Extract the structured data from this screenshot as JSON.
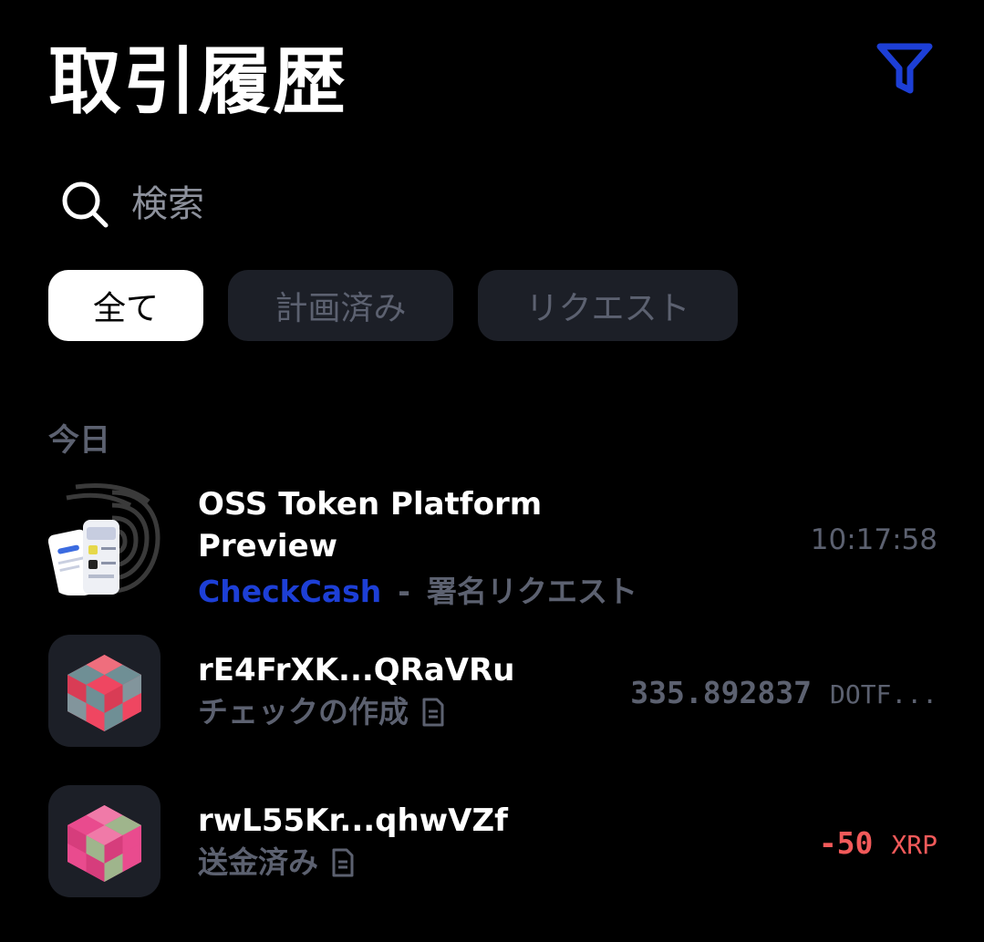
{
  "header": {
    "title": "取引履歴",
    "filter_icon": "filter-icon"
  },
  "search": {
    "placeholder": "検索",
    "value": ""
  },
  "tabs": [
    {
      "label": "全て",
      "active": true
    },
    {
      "label": "計画済み",
      "active": false
    },
    {
      "label": "リクエスト",
      "active": false
    }
  ],
  "section": {
    "label": "今日"
  },
  "transactions": [
    {
      "title_line1": "OSS Token Platform",
      "title_line2": "Preview",
      "source": "CheckCash",
      "separator": "-",
      "type": "署名リクエスト",
      "time": "10:17:58"
    },
    {
      "name": "rE4FrXK...QRaVRu",
      "type": "チェックの作成",
      "amount": "335.892837",
      "currency": "DOTF..."
    },
    {
      "name": "rwL55Kr...qhwVZf",
      "type": "送金済み",
      "amount": "-50",
      "currency": "XRP"
    }
  ],
  "colors": {
    "accent_blue": "#1d3fd6",
    "muted": "#5c6170",
    "negative": "#f25a5a",
    "tab_bg": "#1c1f27"
  }
}
